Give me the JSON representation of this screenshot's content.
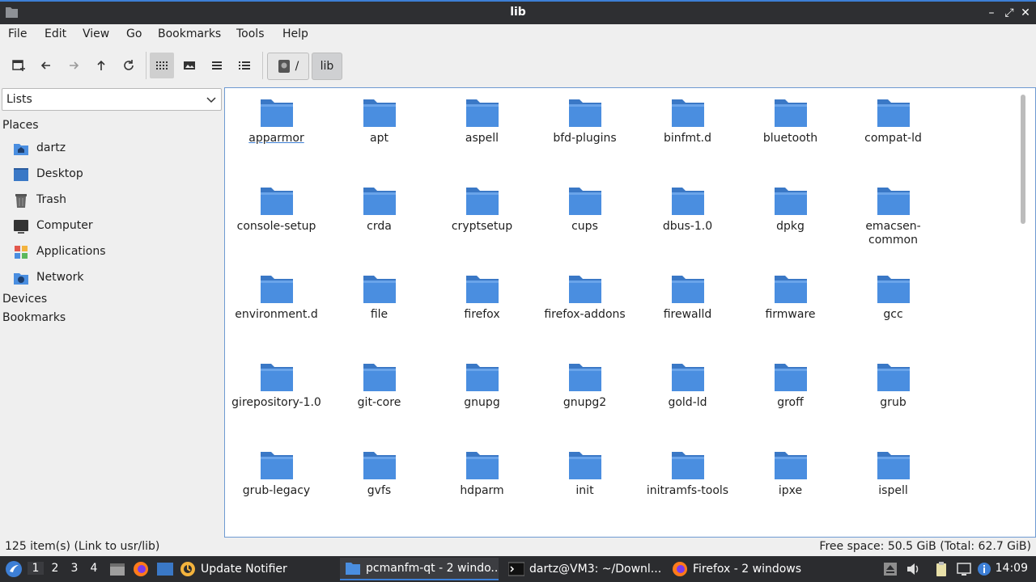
{
  "window": {
    "title": "lib"
  },
  "menu": [
    "File",
    "Edit",
    "View",
    "Go",
    "Bookmarks",
    "Tools",
    "Help"
  ],
  "breadcrumb": {
    "root": "/",
    "current": "lib"
  },
  "sidebar": {
    "mode": "Lists",
    "places_header": "Places",
    "places": [
      {
        "label": "dartz",
        "icon": "home-folder-icon"
      },
      {
        "label": "Desktop",
        "icon": "desktop-icon"
      },
      {
        "label": "Trash",
        "icon": "trash-icon"
      },
      {
        "label": "Computer",
        "icon": "computer-icon"
      },
      {
        "label": "Applications",
        "icon": "applications-icon"
      },
      {
        "label": "Network",
        "icon": "network-icon"
      }
    ],
    "devices_header": "Devices",
    "bookmarks_header": "Bookmarks"
  },
  "folders": [
    [
      "apparmor",
      "apt",
      "aspell",
      "bfd-plugins",
      "binfmt.d",
      "bluetooth",
      "compat-ld"
    ],
    [
      "console-setup",
      "crda",
      "cryptsetup",
      "cups",
      "dbus-1.0",
      "dpkg",
      "emacsen-\ncommon"
    ],
    [
      "environment.d",
      "file",
      "firefox",
      "firefox-addons",
      "firewalld",
      "firmware",
      "gcc"
    ],
    [
      "girepository-1.0",
      "git-core",
      "gnupg",
      "gnupg2",
      "gold-ld",
      "groff",
      "grub"
    ],
    [
      "grub-legacy",
      "gvfs",
      "hdparm",
      "init",
      "initramfs-tools",
      "ipxe",
      "ispell"
    ]
  ],
  "status": {
    "left": "125 item(s) (Link to usr/lib)",
    "right": "Free space: 50.5 GiB (Total: 62.7 GiB)"
  },
  "taskbar": {
    "desktops": [
      "1",
      "2",
      "3",
      "4"
    ],
    "tasks": [
      {
        "label": "Update Notifier",
        "icon": "update-notifier-icon"
      },
      {
        "label": "pcmanfm-qt - 2 windo...",
        "icon": "file-manager-icon"
      },
      {
        "label": "dartz@VM3: ~/Downl...",
        "icon": "terminal-icon"
      },
      {
        "label": "Firefox - 2 windows",
        "icon": "firefox-icon"
      }
    ],
    "clock": "14:09"
  },
  "colors": {
    "accent": "#3d7fd6",
    "folder": "#4a8ee0",
    "folder_tab": "#3a78c6"
  }
}
